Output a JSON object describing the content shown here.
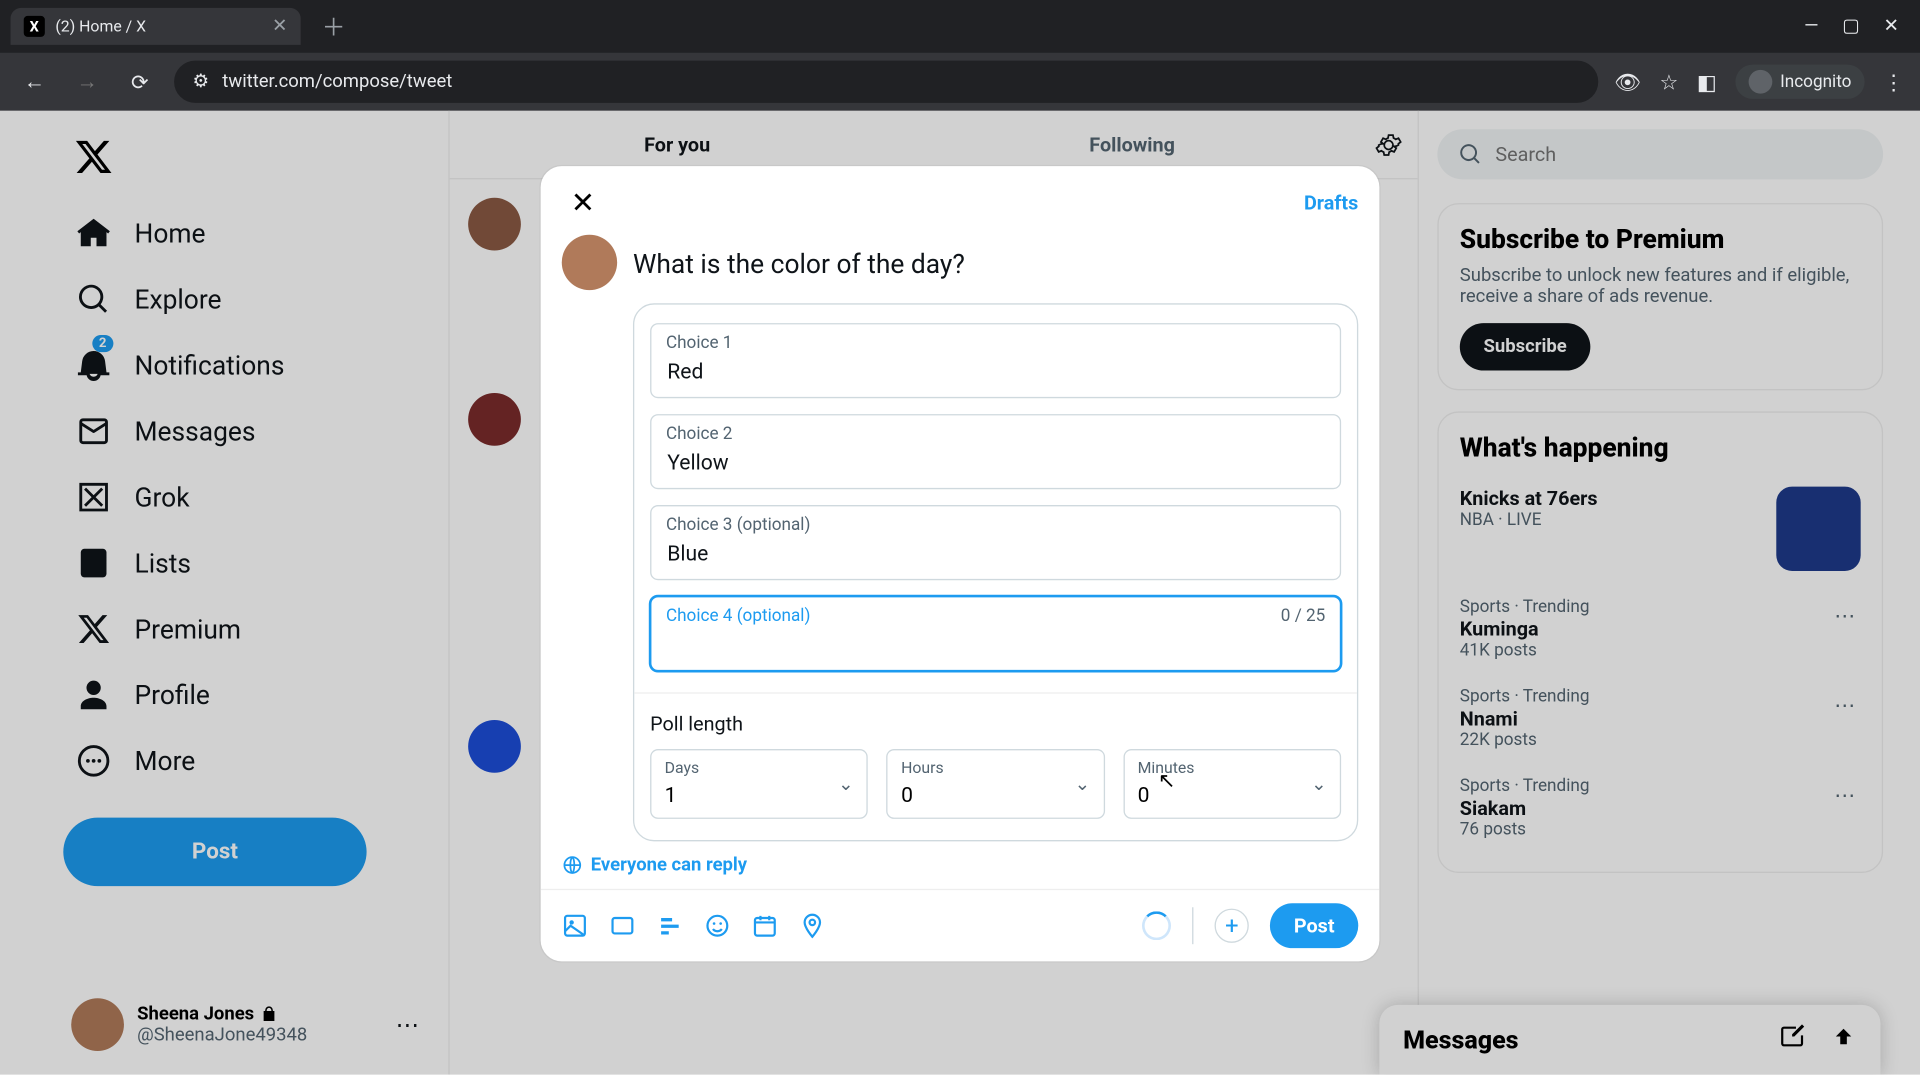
{
  "browser": {
    "tab_title": "(2) Home / X",
    "url": "twitter.com/compose/tweet",
    "incognito_label": "Incognito"
  },
  "nav": {
    "home": "Home",
    "explore": "Explore",
    "notifications": "Notifications",
    "notifications_badge": "2",
    "messages": "Messages",
    "grok": "Grok",
    "lists": "Lists",
    "premium": "Premium",
    "profile": "Profile",
    "more": "More",
    "post": "Post"
  },
  "me": {
    "display_name": "Sheena Jones",
    "handle": "@SheenaJone49348"
  },
  "tabs": {
    "for_you": "For you",
    "following": "Following"
  },
  "search": {
    "placeholder": "Search"
  },
  "premium_panel": {
    "title": "Subscribe to Premium",
    "body": "Subscribe to unlock new features and if eligible, receive a share of ads revenue.",
    "cta": "Subscribe"
  },
  "happening": {
    "title": "What's happening",
    "items": [
      {
        "meta": "NBA · LIVE",
        "title": "Knicks at 76ers",
        "count": ""
      },
      {
        "meta": "Sports · Trending",
        "title": "Kuminga",
        "count": "41K posts"
      },
      {
        "meta": "Sports · Trending",
        "title": "Nnami",
        "count": "22K posts"
      },
      {
        "meta": "Sports · Trending",
        "title": "Siakam",
        "count": "76 posts"
      }
    ]
  },
  "messages_dock": "Messages",
  "compose": {
    "drafts": "Drafts",
    "question": "What is the color of the day?",
    "choices": {
      "c1_label": "Choice 1",
      "c1_value": "Red",
      "c2_label": "Choice 2",
      "c2_value": "Yellow",
      "c3_label": "Choice 3 (optional)",
      "c3_value": "Blue",
      "c4_label": "Choice 4 (optional)",
      "c4_value": "",
      "c4_counter": "0 / 25"
    },
    "poll_length_title": "Poll length",
    "days_label": "Days",
    "days_value": "1",
    "hours_label": "Hours",
    "hours_value": "0",
    "minutes_label": "Minutes",
    "minutes_value": "0",
    "reply_setting": "Everyone can reply",
    "post": "Post"
  }
}
